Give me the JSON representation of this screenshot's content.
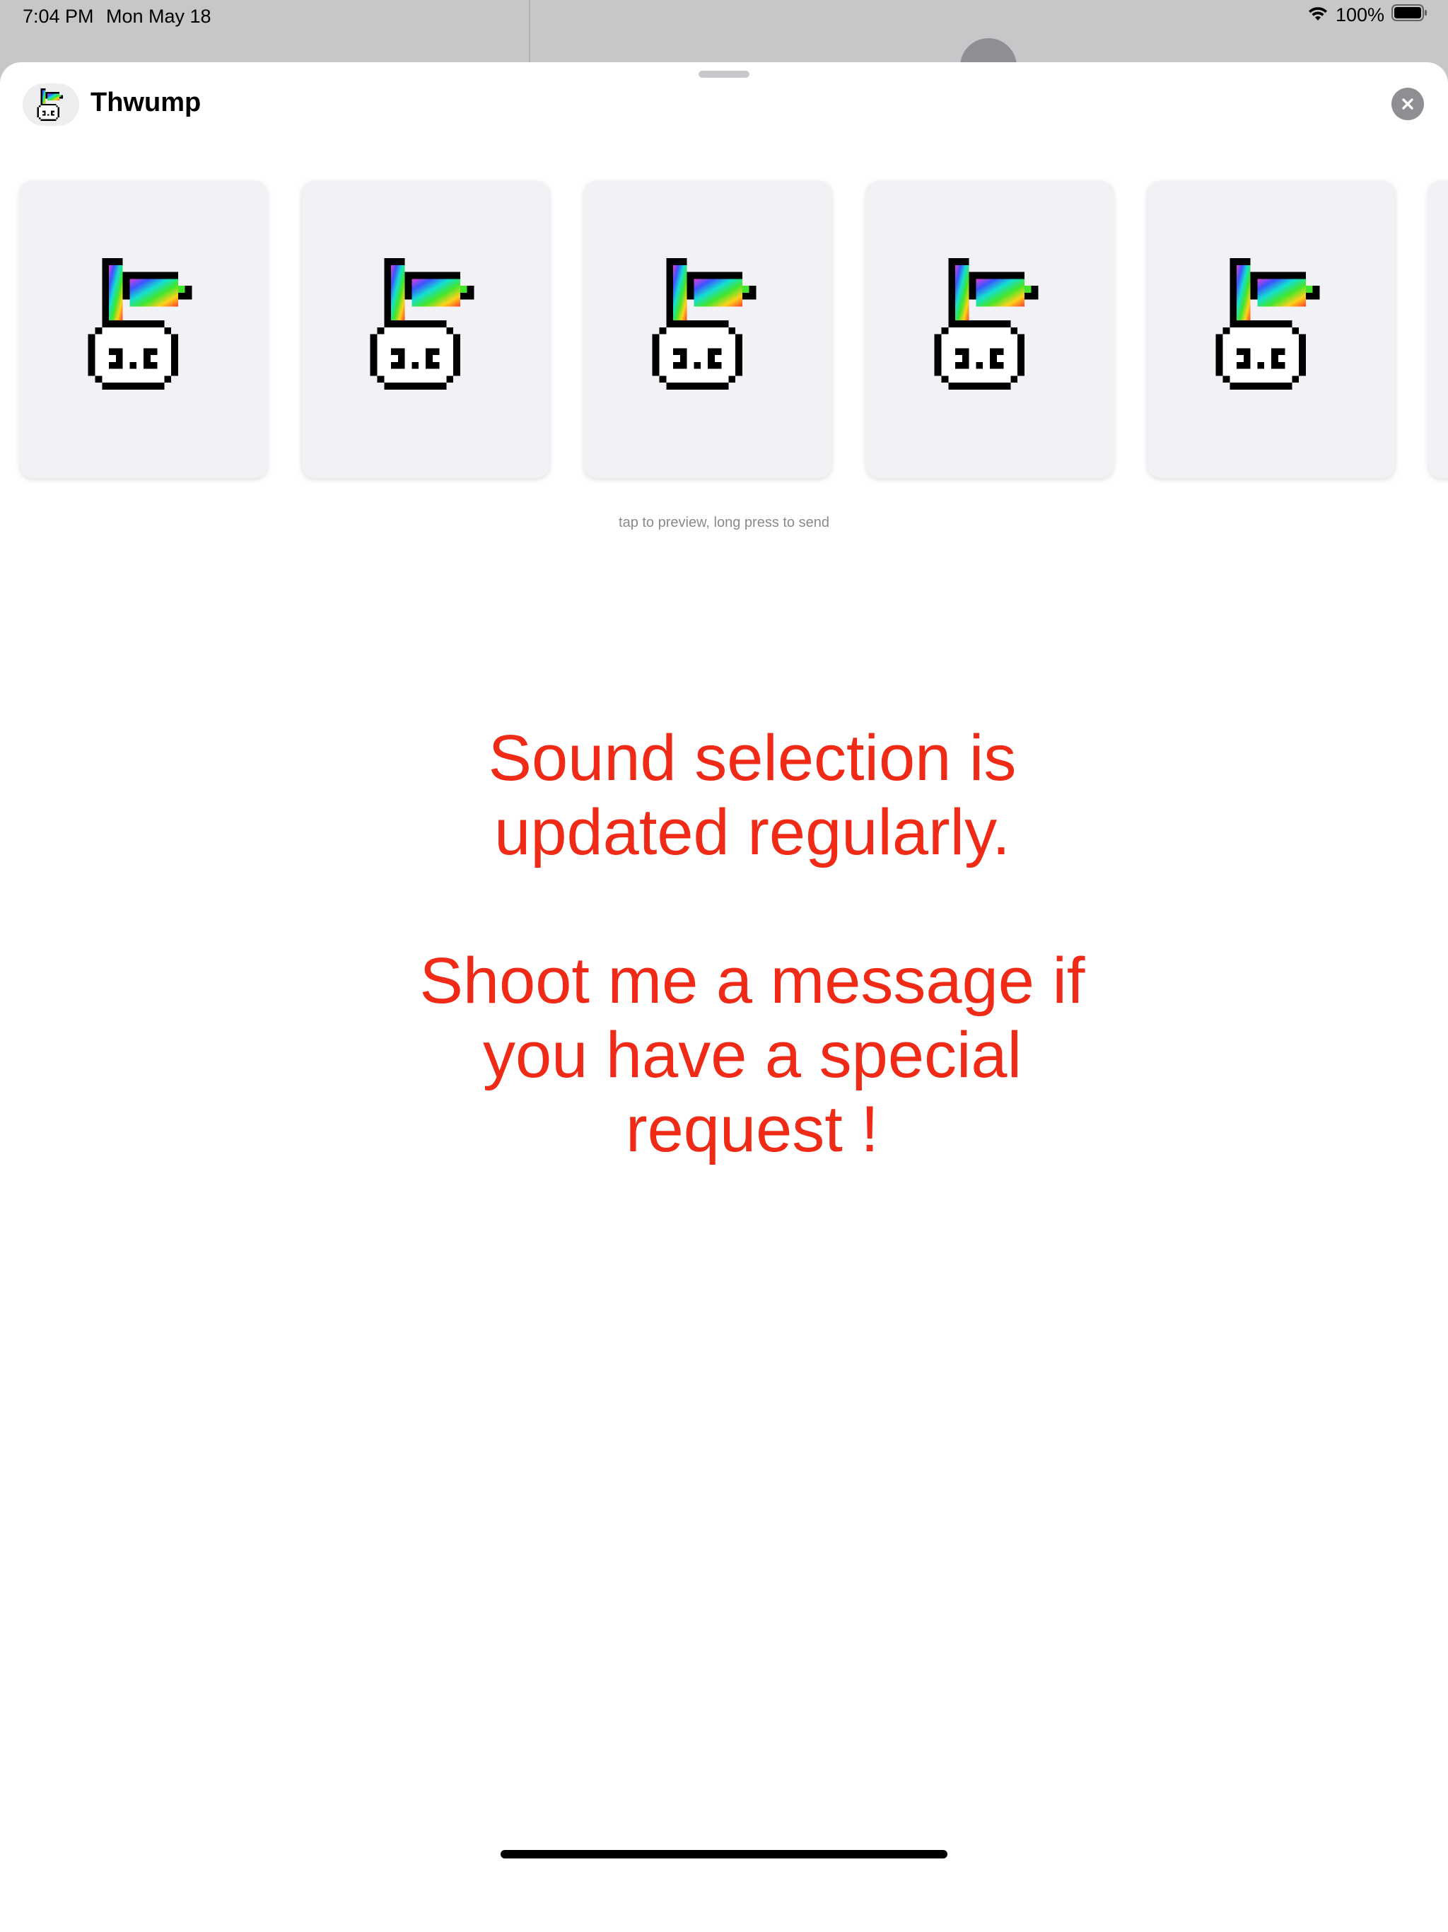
{
  "status_bar": {
    "time": "7:04 PM",
    "date": "Mon May 18",
    "battery": "100%"
  },
  "sheet": {
    "app_name": "Thwump",
    "close_icon": "close-circle-icon",
    "stickers": [
      {
        "icon": "rainbow-bunny-sticker"
      },
      {
        "icon": "rainbow-bunny-sticker"
      },
      {
        "icon": "rainbow-bunny-sticker"
      },
      {
        "icon": "rainbow-bunny-sticker"
      },
      {
        "icon": "rainbow-bunny-sticker"
      }
    ],
    "hint": "tap to preview, long press to send",
    "message_lines": [
      "Sound selection is",
      "updated regularly.",
      "Shoot me a message if",
      "you have a special",
      "request !"
    ]
  },
  "colors": {
    "accent_text": "#ef2a16",
    "sheet_bg": "#ffffff",
    "card_bg": "#f2f2f6"
  }
}
